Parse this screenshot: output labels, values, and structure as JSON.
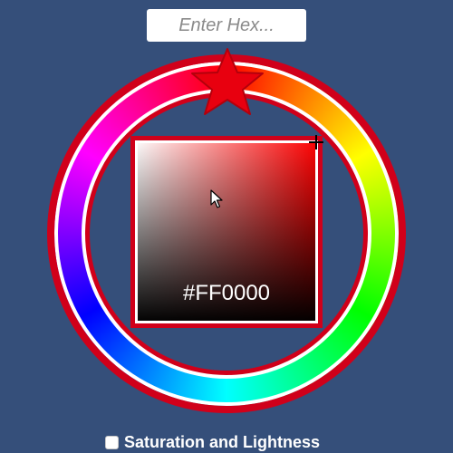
{
  "hex_input": {
    "placeholder": "Enter Hex...",
    "value": ""
  },
  "picker": {
    "hue_icon": "star-handle",
    "selected_hex": "#FF0000",
    "colors": {
      "background": "#354f7a",
      "outline": "#d0001a",
      "handle": "#e8000f"
    }
  },
  "mode_toggle": {
    "label": "Saturation and Lightness",
    "checked": false
  }
}
